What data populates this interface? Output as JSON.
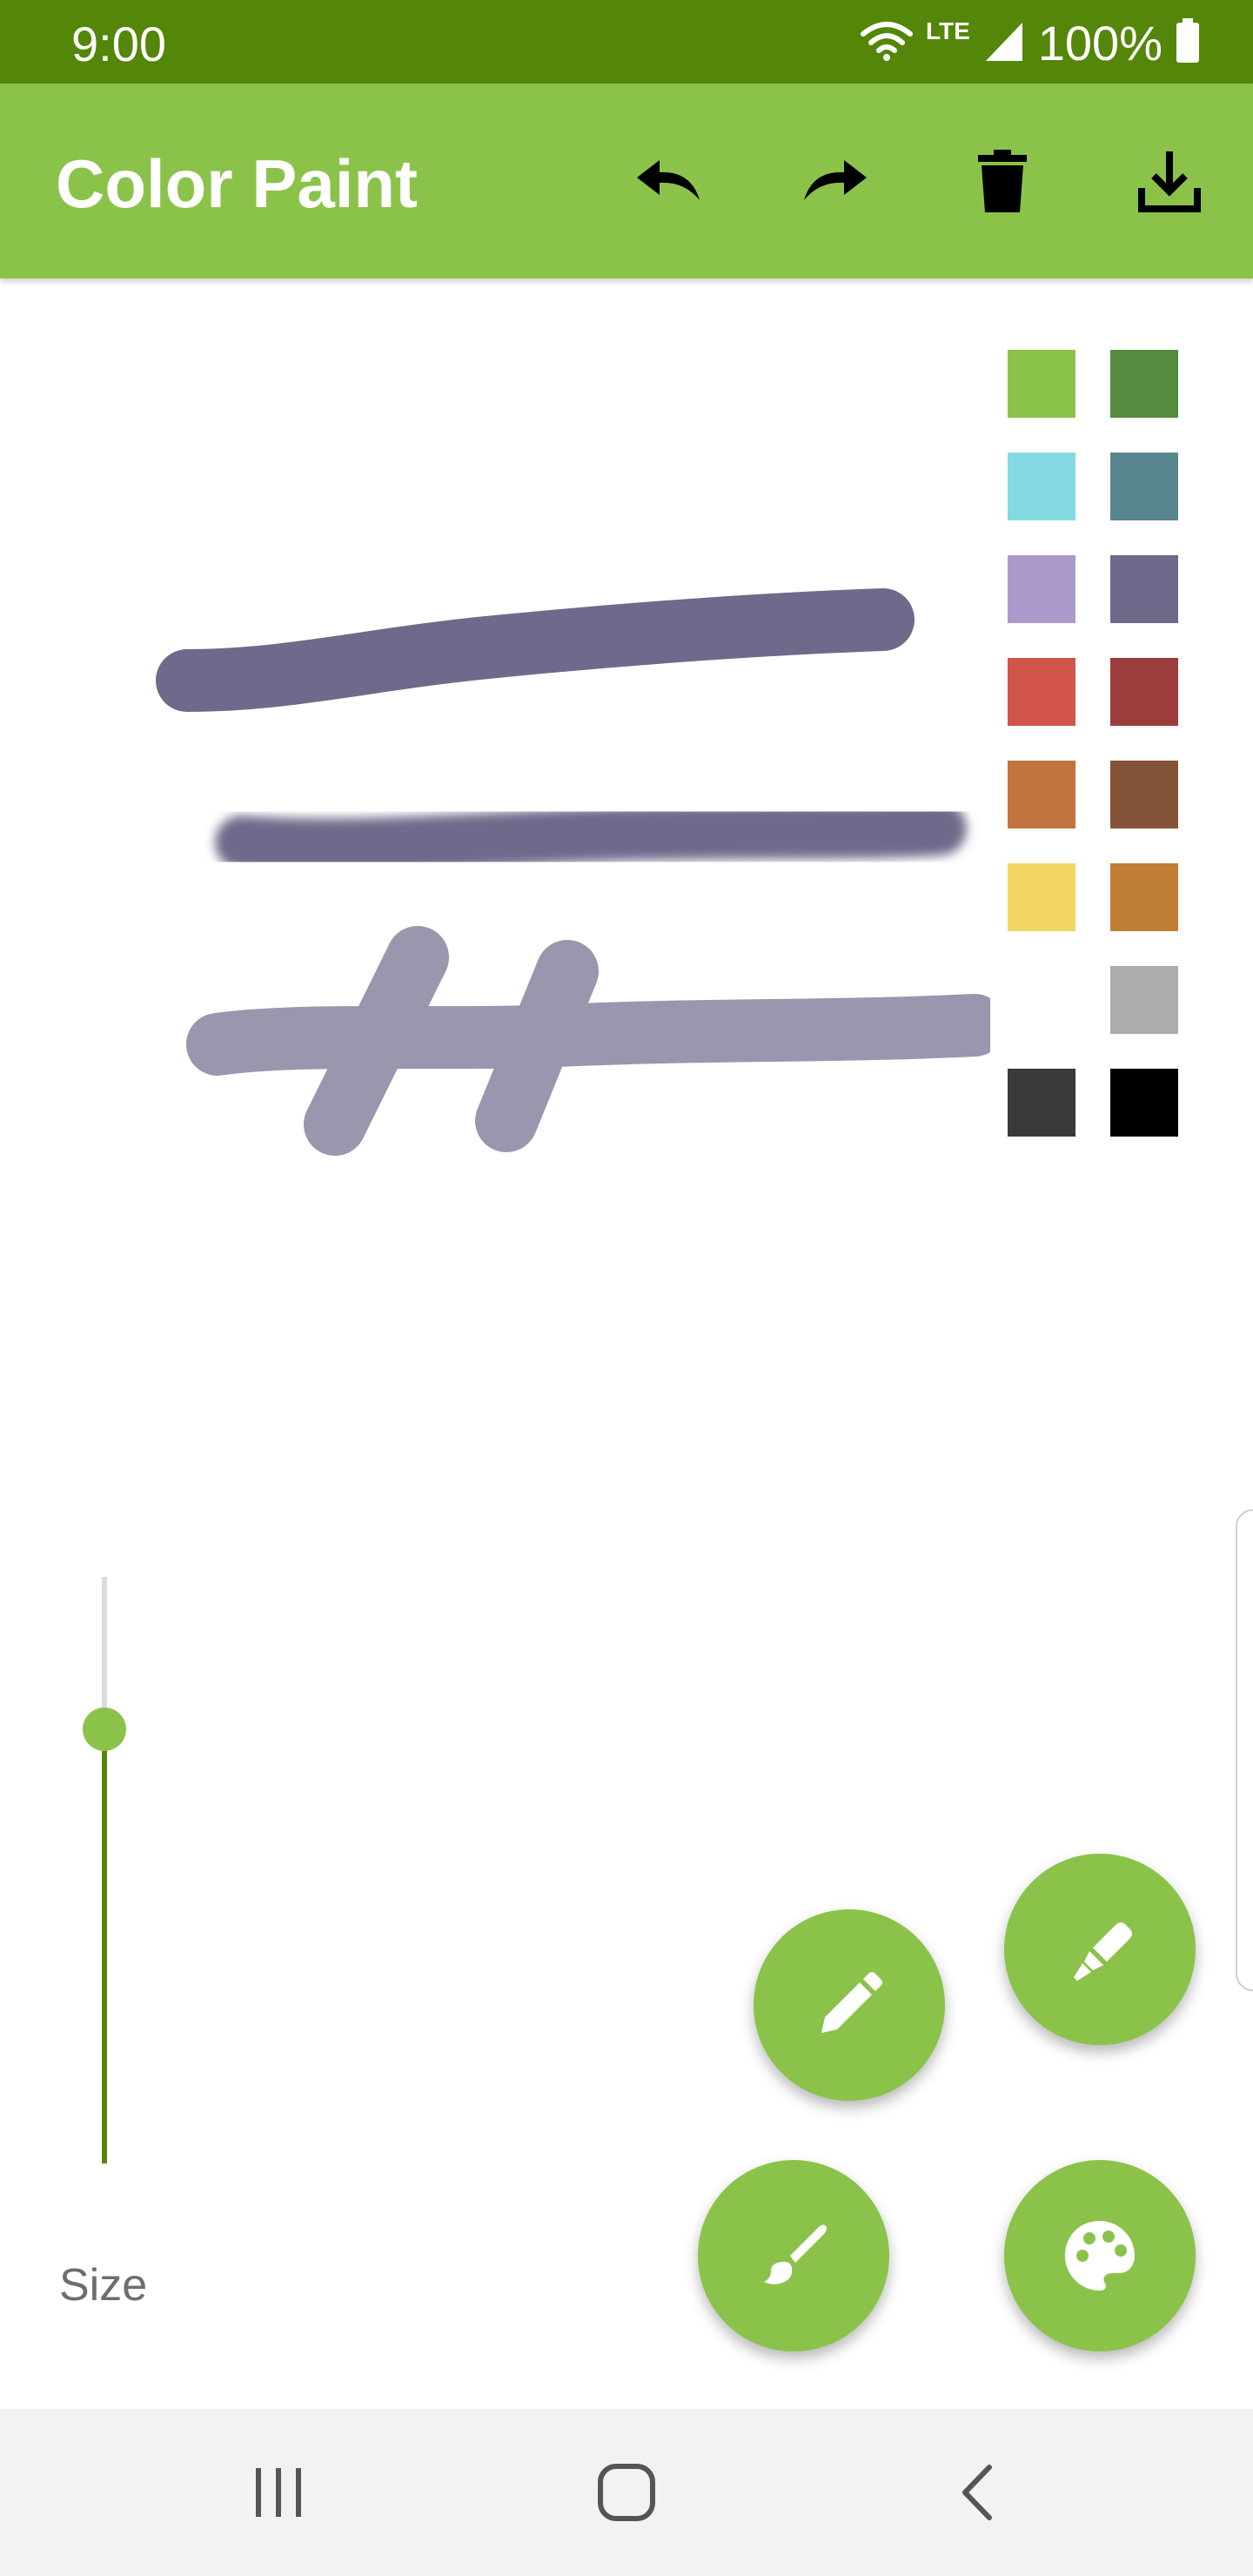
{
  "status_bar": {
    "time": "9:00",
    "network_label": "LTE",
    "battery": "100%",
    "icons": [
      "wifi-icon",
      "signal-icon",
      "battery-icon"
    ]
  },
  "app_bar": {
    "title": "Color Paint",
    "actions": [
      {
        "name": "undo",
        "icon": "undo-icon"
      },
      {
        "name": "redo",
        "icon": "redo-icon"
      },
      {
        "name": "delete",
        "icon": "trash-icon"
      },
      {
        "name": "download",
        "icon": "download-icon"
      }
    ]
  },
  "palette": {
    "colors": [
      "#8bc34a",
      "#558b3f",
      "#84d9e4",
      "#58868f",
      "#ac99cc",
      "#6e6a8b",
      "#d2554a",
      "#9b3c3d",
      "#c2743f",
      "#855337",
      "#f2d664",
      "#c07d36",
      "#ffffff",
      "#acacac",
      "#3a3a3a",
      "#000000"
    ]
  },
  "canvas": {
    "stroke_color": "#6e6a8b",
    "strokes": [
      "solid-stroke",
      "blurred-stroke",
      "translucent-stroke"
    ]
  },
  "size_control": {
    "label": "Size",
    "value_fraction": 0.74
  },
  "tools": [
    {
      "name": "pencil",
      "icon": "pencil-icon"
    },
    {
      "name": "marker",
      "icon": "marker-icon"
    },
    {
      "name": "brush",
      "icon": "brush-icon"
    },
    {
      "name": "palette",
      "icon": "palette-icon"
    }
  ],
  "nav_bar": {
    "icons": [
      "recents-icon",
      "home-icon",
      "back-icon"
    ]
  }
}
